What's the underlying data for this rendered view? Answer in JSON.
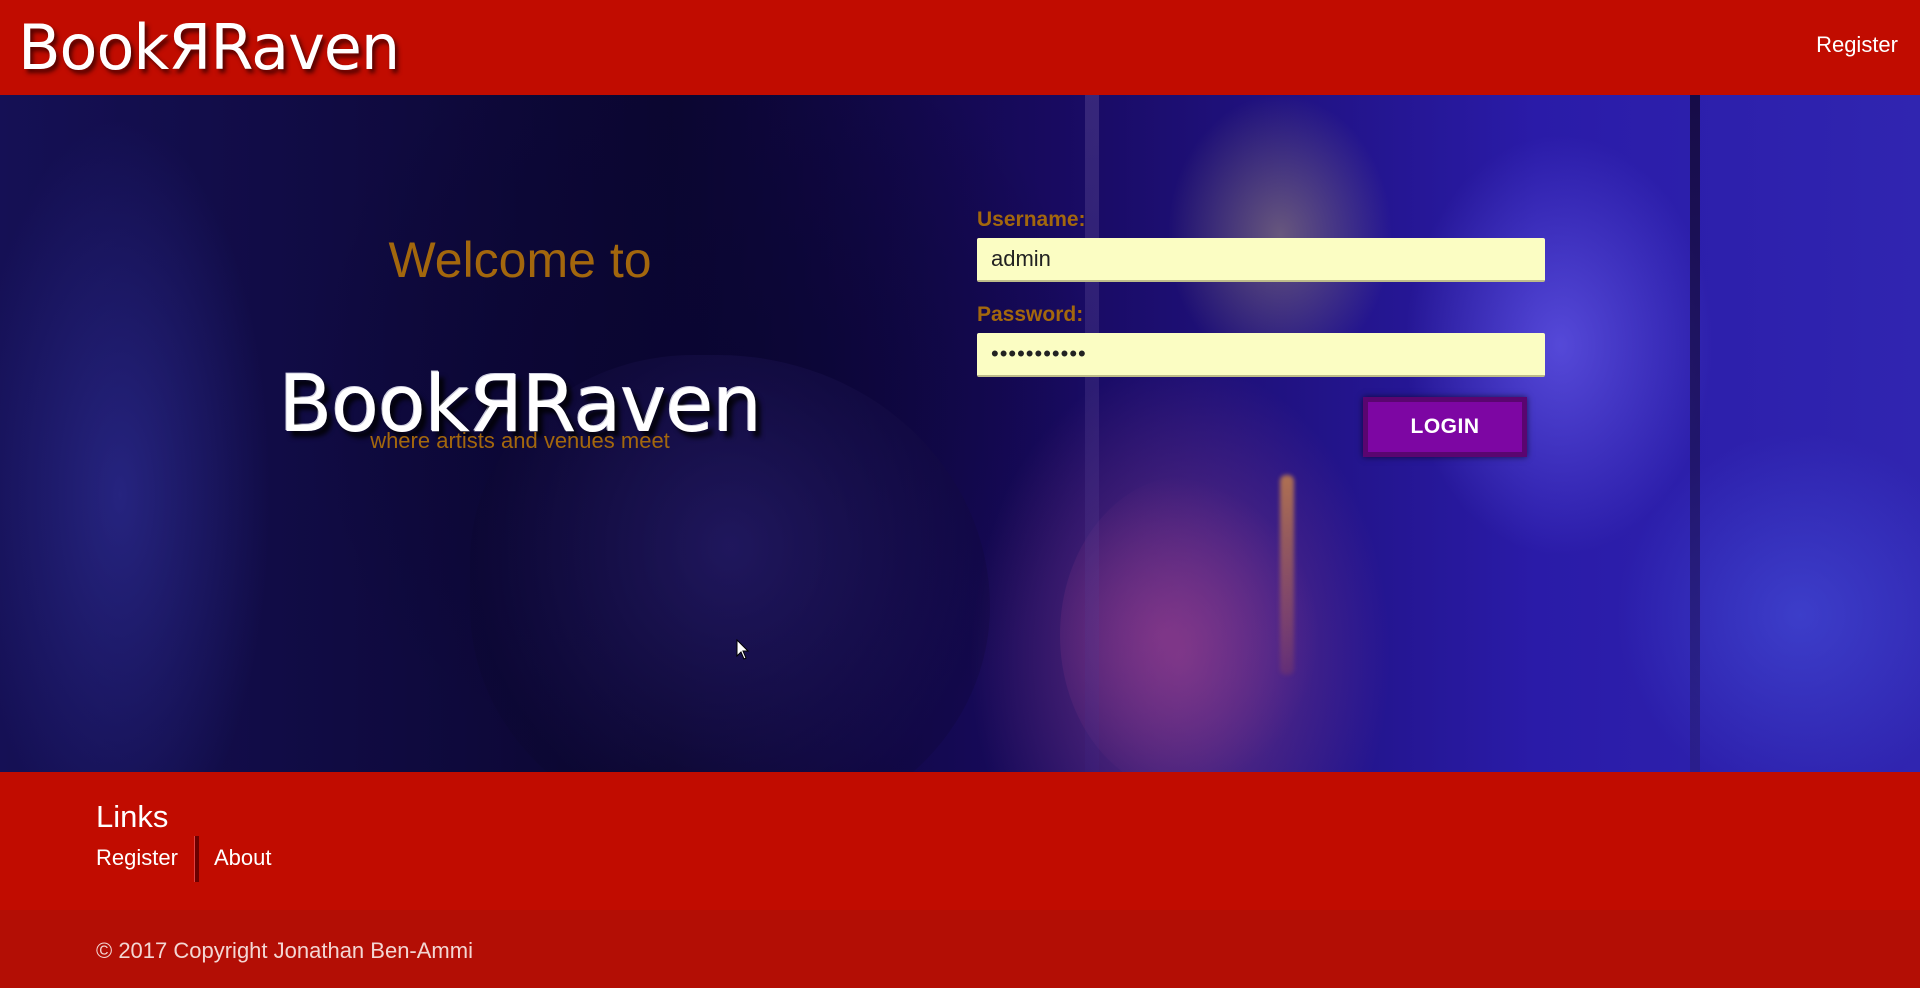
{
  "header": {
    "brand": "BookЯRaven",
    "register_link": "Register"
  },
  "hero": {
    "welcome": "Welcome to",
    "logo": "BookЯRaven",
    "tagline": "where artists and venues meet"
  },
  "login_form": {
    "username_label": "Username:",
    "username_value": "admin",
    "password_label": "Password:",
    "password_value": "•••••••••••",
    "login_button": "LOGIN"
  },
  "footer": {
    "title": "Links",
    "links": [
      "Register",
      "About"
    ],
    "copyright": "© 2017 Copyright Jonathan Ben-Ammi"
  },
  "colors": {
    "header_red": "#c10c00",
    "accent_gold": "#a3670d",
    "button_purple": "#7d06a3",
    "input_bg": "#fbfdc3"
  }
}
